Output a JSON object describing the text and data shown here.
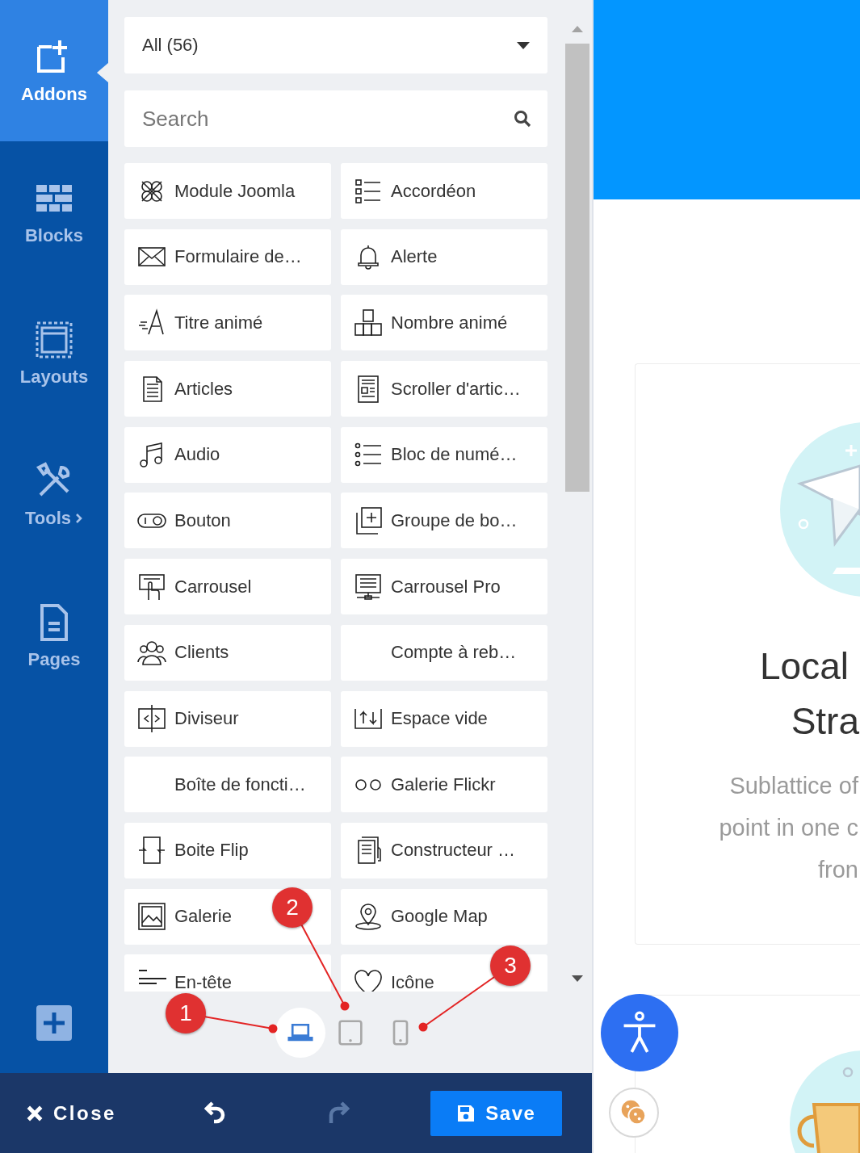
{
  "sidebar": {
    "items": [
      {
        "label": "Addons",
        "selected": true,
        "submenu": false
      },
      {
        "label": "Blocks",
        "selected": false,
        "submenu": false
      },
      {
        "label": "Layouts",
        "selected": false,
        "submenu": false
      },
      {
        "label": "Tools",
        "selected": false,
        "submenu": true
      },
      {
        "label": "Pages",
        "selected": false,
        "submenu": false
      }
    ]
  },
  "panel": {
    "filter": {
      "value": "All (56)"
    },
    "search": {
      "placeholder": "Search"
    },
    "addons": [
      {
        "label": "Module Joomla"
      },
      {
        "label": "Accordéon"
      },
      {
        "label": "Formulaire de…"
      },
      {
        "label": "Alerte"
      },
      {
        "label": "Titre animé"
      },
      {
        "label": "Nombre animé"
      },
      {
        "label": "Articles"
      },
      {
        "label": "Scroller d'artic…"
      },
      {
        "label": "Audio"
      },
      {
        "label": "Bloc de numé…"
      },
      {
        "label": "Bouton"
      },
      {
        "label": "Groupe de bo…"
      },
      {
        "label": "Carrousel"
      },
      {
        "label": "Carrousel Pro"
      },
      {
        "label": "Clients"
      },
      {
        "label": "Compte à reb…"
      },
      {
        "label": "Diviseur"
      },
      {
        "label": "Espace vide"
      },
      {
        "label": "Boîte de foncti…"
      },
      {
        "label": "Galerie Flickr"
      },
      {
        "label": "Boite Flip"
      },
      {
        "label": "Constructeur …"
      },
      {
        "label": "Galerie"
      },
      {
        "label": "Google Map"
      },
      {
        "label": "En-tête"
      },
      {
        "label": "Icône"
      }
    ],
    "device_buttons": [
      {
        "selected": true
      },
      {
        "selected": false
      },
      {
        "selected": false
      }
    ]
  },
  "footer": {
    "close": "Close",
    "undo": {
      "disabled": false
    },
    "redo": {
      "disabled": true
    },
    "save": "Save"
  },
  "preview": {
    "card": {
      "title_lines": [
        "Local",
        "Stra"
      ],
      "text_lines": [
        "Sublattice of",
        "point in one c",
        "fron"
      ]
    }
  },
  "annotations": [
    {
      "label": "1"
    },
    {
      "label": "2"
    },
    {
      "label": "3"
    }
  ]
}
